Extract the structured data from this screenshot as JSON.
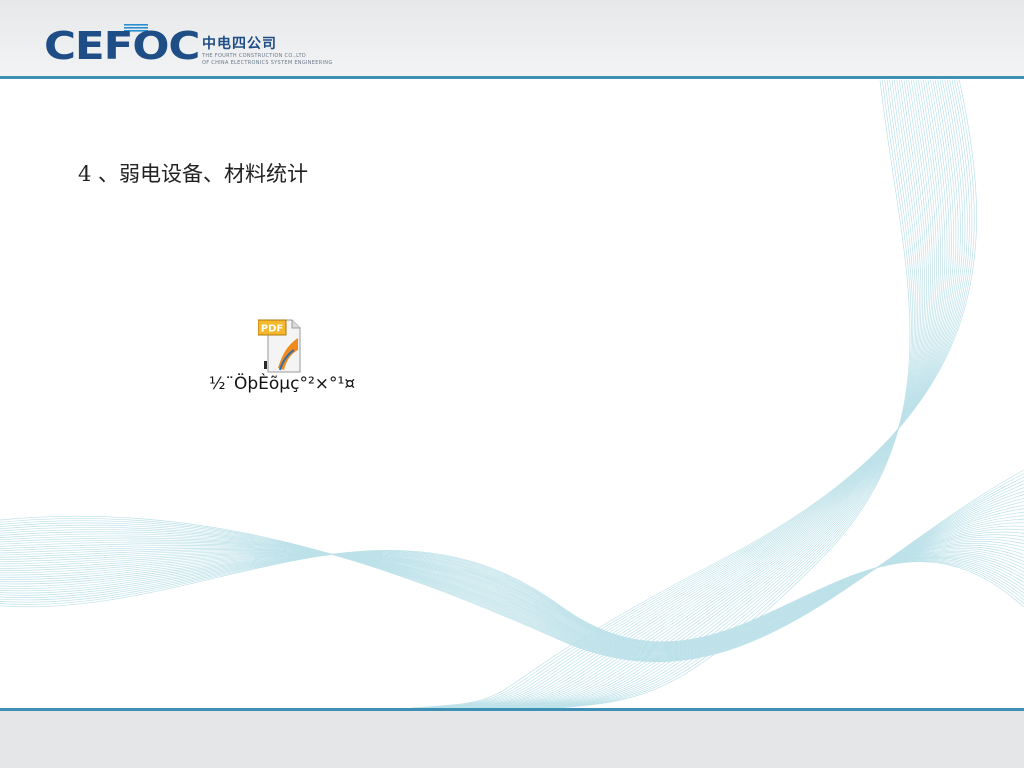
{
  "header": {
    "logo_text": "CEFOC",
    "company_cn": "中电四公司",
    "company_en_line1": "THE FOURTH CONSTRUCTION CO.,LTD",
    "company_en_line2": "OF CHINA ELECTRONICS SYSTEM ENGINEERING"
  },
  "slide": {
    "title": "4 、弱电设备、材料统计"
  },
  "attachment": {
    "icon": "pdf-file-icon",
    "badge": "PDF",
    "label": "½¨ÖþÈõµç°²×°¹¤"
  },
  "colors": {
    "brand": "#1f4e86",
    "accent_line": "#3f8fb5",
    "wave": "#9fd3df"
  }
}
